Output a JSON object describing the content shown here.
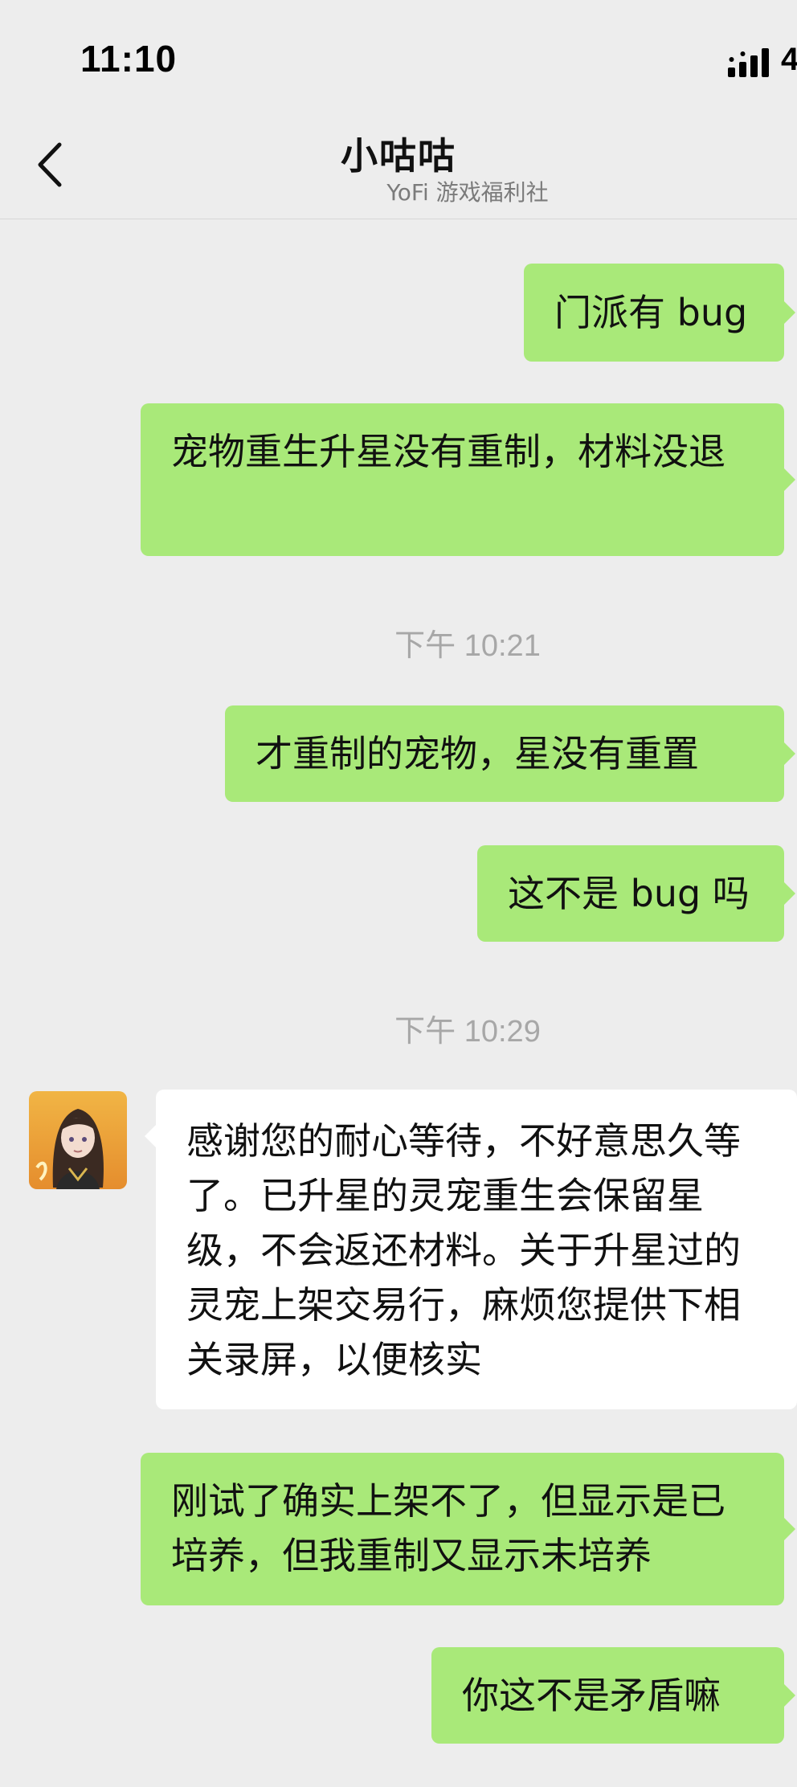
{
  "status_bar": {
    "time": "11:10",
    "network": "4"
  },
  "header": {
    "title": "小咕咕",
    "subtitle": "YoFi 游戏福利社"
  },
  "messages": [
    {
      "side": "sent",
      "text": "门派有 bug"
    },
    {
      "side": "sent",
      "text": "宠物重生升星没有重制，材料没退"
    },
    {
      "type": "timestamp",
      "text": "下午 10:21"
    },
    {
      "side": "sent",
      "text": "才重制的宠物，星没有重置"
    },
    {
      "side": "sent",
      "text": "这不是 bug 吗"
    },
    {
      "type": "timestamp",
      "text": "下午 10:29"
    },
    {
      "side": "received",
      "text": "感谢您的耐心等待，不好意思久等了。已升星的灵宠重生会保留星级，不会返还材料。关于升星过的灵宠上架交易行，麻烦您提供下相关录屏，以便核实"
    },
    {
      "side": "sent",
      "text": "刚试了确实上架不了，但显示是已培养，但我重制又显示未培养"
    },
    {
      "side": "sent",
      "text": "你这不是矛盾嘛"
    }
  ],
  "colors": {
    "background": "#ededed",
    "sent_bubble": "#a9e979",
    "received_bubble": "#ffffff",
    "timestamp": "#a7a7a7"
  }
}
